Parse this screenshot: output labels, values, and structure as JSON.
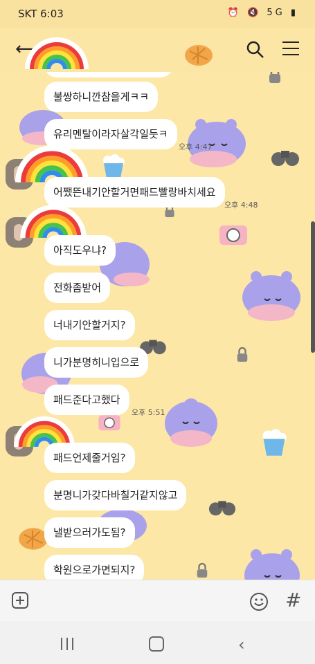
{
  "status": {
    "carrier": "SKT 6:03",
    "icons": "⏰ 🔇 5G ▮"
  },
  "chat": {
    "messages": [
      {
        "text": "불쌍하니깐참을게ㅋㅋ"
      },
      {
        "text": "유리멘탈이라자살각일듯ㅋ"
      },
      {
        "text": "오후 4:47"
      },
      {
        "text": "어쨌뜬내기안할거면패드빨랑바치세요"
      },
      {
        "text": "오후 4:48"
      },
      {
        "text": "아직도우냐?"
      },
      {
        "text": "전화좀받어"
      },
      {
        "text": "너내기안할거지?"
      },
      {
        "text": "니가분명히니입으로"
      },
      {
        "text": "패드준다고했다"
      },
      {
        "text": "오후 5:51"
      },
      {
        "text": "패드언제줄거임?"
      },
      {
        "text": "분명니가갖다바칠거같지않고"
      },
      {
        "text": "낼받으러가도됨?"
      },
      {
        "text": "학원으로가면되지?"
      }
    ]
  },
  "colors": {
    "background": "#fde7a6",
    "bubble": "#ffffff",
    "hippo": "#aaa1eb"
  }
}
